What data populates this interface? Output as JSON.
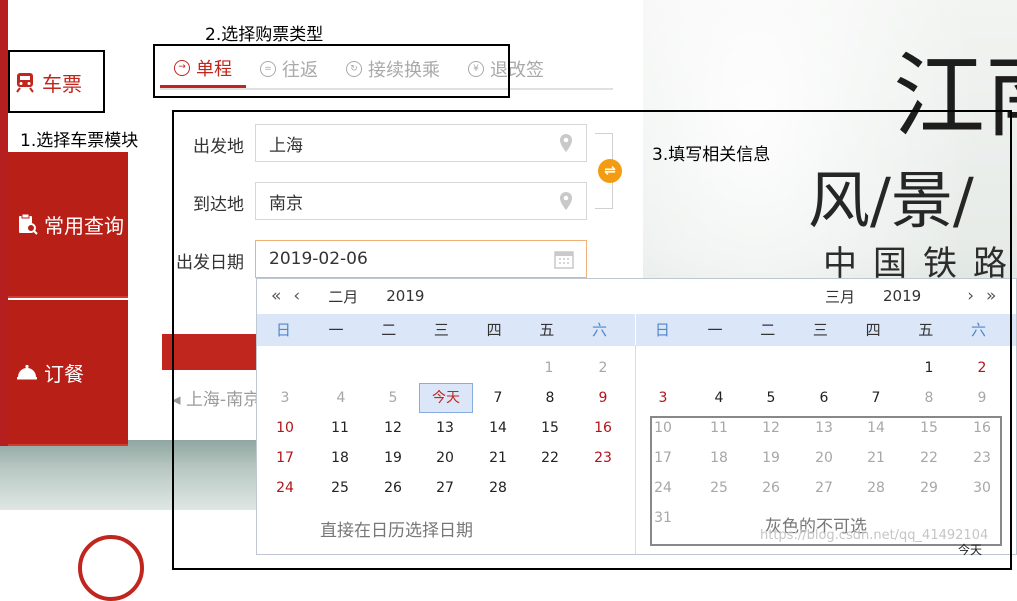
{
  "annotations": {
    "step1": "1.选择车票模块",
    "step2": "2.选择购票类型",
    "step3": "3.填写相关信息",
    "pick_date_note": "直接在日历选择日期",
    "grey_note": "灰色的不可选"
  },
  "sidebar": {
    "items": [
      {
        "label": "车票",
        "icon": "train-icon"
      },
      {
        "label": "常用查询",
        "icon": "clipboard-search-icon"
      },
      {
        "label": "订餐",
        "icon": "food-cloche-icon"
      }
    ]
  },
  "tabs": [
    {
      "label": "单程",
      "icon": "arrow-circle-icon",
      "active": true
    },
    {
      "label": "往返",
      "icon": "round-trip-icon",
      "active": false
    },
    {
      "label": "接续换乘",
      "icon": "transfer-icon",
      "active": false
    },
    {
      "label": "退改签",
      "icon": "refund-icon",
      "active": false
    }
  ],
  "form": {
    "from_label": "出发地",
    "from_value": "上海",
    "to_label": "到达地",
    "to_value": "南京",
    "date_label": "出发日期",
    "date_value": "2019-02-06",
    "swap_symbol": "⇌"
  },
  "history": {
    "text": "上海-南京"
  },
  "background": {
    "title1": "江南",
    "title2": "风/景/",
    "title3": "中国铁路"
  },
  "calendar": {
    "left": {
      "month": "二月",
      "year": "2019",
      "weekdays": [
        "日",
        "一",
        "二",
        "三",
        "四",
        "五",
        "六"
      ],
      "today_label": "今天"
    },
    "right": {
      "month": "三月",
      "year": "2019",
      "weekdays": [
        "日",
        "一",
        "二",
        "三",
        "四",
        "五",
        "六"
      ]
    },
    "nav": {
      "prev_year": "«",
      "prev_month": "‹",
      "next_month": "›",
      "next_year": "»"
    }
  },
  "watermark": "https://blog.csdn.net/qq_41492104",
  "footer_today": "今天",
  "colors": {
    "brand_red": "#c0261d",
    "holiday_red": "#b2141a",
    "weekend_blue": "#4f86c9",
    "swap_orange": "#f39c12",
    "header_bg": "#dbe7f8"
  }
}
